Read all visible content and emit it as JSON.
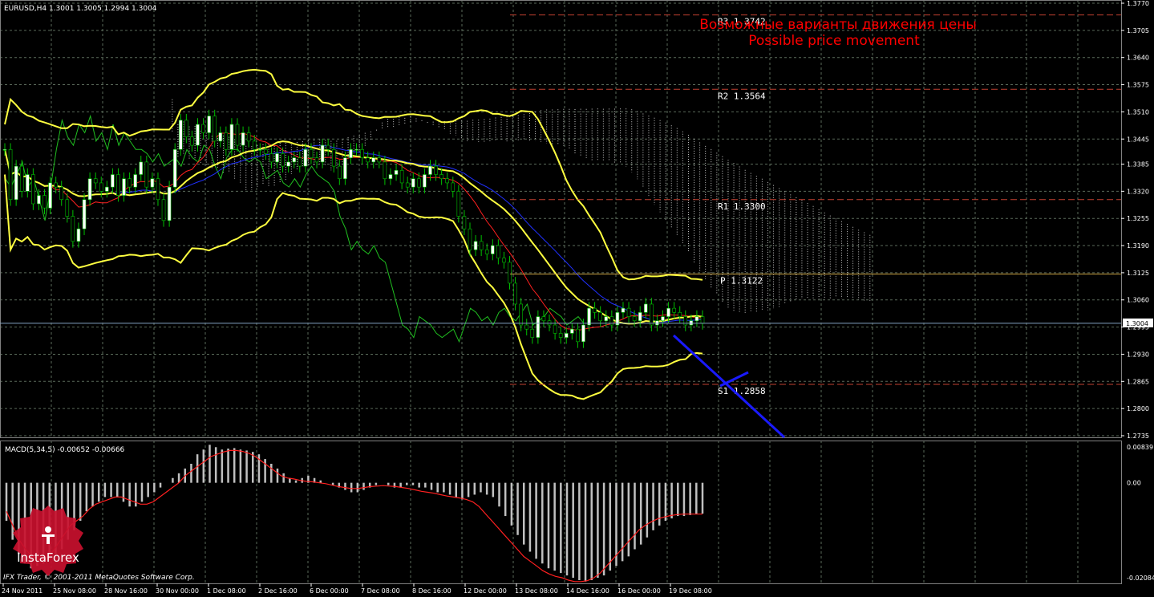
{
  "colors": {
    "background": "#000000",
    "grid": "#5a6a5a",
    "bull": "#ffffff",
    "bear": "#000000",
    "wick": "#00c000",
    "bollinger": "#ffff40",
    "tenkan": "#ff2020",
    "kijun": "#2030ff",
    "chikou": "#20c020",
    "cloud": "#c8c8c8",
    "pivot_level": "#c04030",
    "pivot_p": "#c8a040",
    "forecast": "#1a1aff",
    "price_line": "#80a0c0",
    "annotation": "#ff0000",
    "macd_hist": "#c0c0c0",
    "macd_signal": "#ff2020",
    "axis_text": "#ffffff"
  },
  "header": {
    "symbol_info": "EURUSD,H4  1.3001 1.3005 1.2994 1.3004"
  },
  "annotation": {
    "line1": "Возможные варианты движения цены",
    "line2": "Possible price movement"
  },
  "pivots": [
    {
      "label": "R3",
      "value": "1.3742",
      "price": 1.3742
    },
    {
      "label": "R2",
      "value": "1.3564",
      "price": 1.3564
    },
    {
      "label": "R1",
      "value": "1.3300",
      "price": 1.33
    },
    {
      "label": "P",
      "value": "1.3122",
      "price": 1.3122
    },
    {
      "label": "S1",
      "value": "1.2858",
      "price": 1.2858
    }
  ],
  "current_price": "1.3004",
  "macd": {
    "label": "MACD(5,34,5) -0.00652 -0.00666",
    "yticks": [
      "0.00839",
      "0.00",
      "-0.02084"
    ]
  },
  "footer": {
    "copyright": "IFX Trader, © 2001-2011 MetaQuotes Software Corp."
  },
  "logo": {
    "brand": "InstaForex"
  },
  "chart_data": {
    "type": "candlestick",
    "title": "EURUSD,H4",
    "ylim": [
      1.2735,
      1.377
    ],
    "yticks": [
      "1.3770",
      "1.3705",
      "1.3640",
      "1.3575",
      "1.3510",
      "1.3445",
      "1.3385",
      "1.3320",
      "1.3255",
      "1.3190",
      "1.3125",
      "1.3060",
      "1.2995",
      "1.2930",
      "1.2865",
      "1.2800",
      "1.2735"
    ],
    "xticks": [
      "24 Nov 2011",
      "25 Nov 08:00",
      "28 Nov 16:00",
      "30 Nov 00:00",
      "1 Dec 08:00",
      "2 Dec 16:00",
      "6 Dec 00:00",
      "7 Dec 08:00",
      "8 Dec 16:00",
      "12 Dec 00:00",
      "13 Dec 08:00",
      "14 Dec 16:00",
      "16 Dec 00:00",
      "19 Dec 08:00"
    ],
    "close": [
      1.342,
      1.33,
      1.338,
      1.332,
      1.336,
      1.329,
      1.331,
      1.328,
      1.334,
      1.333,
      1.33,
      1.326,
      1.32,
      1.323,
      1.33,
      1.335,
      1.334,
      1.332,
      1.333,
      1.336,
      1.331,
      1.335,
      1.333,
      1.336,
      1.339,
      1.333,
      1.335,
      1.33,
      1.325,
      1.333,
      1.342,
      1.349,
      1.345,
      1.343,
      1.348,
      1.346,
      1.35,
      1.344,
      1.346,
      1.342,
      1.348,
      1.343,
      1.346,
      1.344,
      1.342,
      1.342,
      1.341,
      1.339,
      1.341,
      1.338,
      1.339,
      1.34,
      1.338,
      1.342,
      1.34,
      1.339,
      1.343,
      1.342,
      1.338,
      1.335,
      1.34,
      1.342,
      1.342,
      1.34,
      1.339,
      1.34,
      1.339,
      1.335,
      1.336,
      1.337,
      1.334,
      1.333,
      1.335,
      1.333,
      1.336,
      1.338,
      1.336,
      1.335,
      1.334,
      1.332,
      1.326,
      1.323,
      1.318,
      1.32,
      1.318,
      1.317,
      1.319,
      1.316,
      1.315,
      1.31,
      1.305,
      1.3,
      1.299,
      1.297,
      1.302,
      1.301,
      1.3,
      1.298,
      1.297,
      1.298,
      1.299,
      1.296,
      1.3,
      1.304,
      1.303,
      1.301,
      1.302,
      1.3,
      1.303,
      1.304,
      1.302,
      1.301,
      1.303,
      1.305,
      1.3,
      1.301,
      1.302,
      1.304,
      1.303,
      1.302,
      1.3,
      1.301,
      1.302,
      1.3004
    ],
    "macd_hist": [
      -0.008,
      -0.012,
      -0.015,
      -0.017,
      -0.018,
      -0.0175,
      -0.017,
      -0.016,
      -0.015,
      -0.014,
      -0.012,
      -0.01,
      -0.008,
      -0.006,
      -0.005,
      -0.004,
      -0.003,
      -0.003,
      -0.003,
      -0.004,
      -0.005,
      -0.005,
      -0.004,
      -0.003,
      -0.002,
      -0.001,
      0.0,
      0.001,
      0.002,
      0.003,
      0.004,
      0.006,
      0.007,
      0.008,
      0.0075,
      0.007,
      0.0072,
      0.0073,
      0.007,
      0.0068,
      0.0065,
      0.006,
      0.005,
      0.004,
      0.003,
      0.002,
      0.001,
      0.0005,
      0.001,
      0.0015,
      0.001,
      0.0005,
      0.0,
      -0.0005,
      -0.001,
      -0.0015,
      -0.002,
      -0.002,
      -0.0015,
      -0.001,
      -0.0005,
      0.0,
      -0.0005,
      -0.001,
      -0.001,
      -0.0005,
      -0.0005,
      -0.001,
      -0.001,
      -0.0015,
      -0.002,
      -0.002,
      -0.0025,
      -0.003,
      -0.0035,
      -0.003,
      -0.0025,
      -0.002,
      -0.0025,
      -0.003,
      -0.005,
      -0.007,
      -0.009,
      -0.011,
      -0.013,
      -0.0145,
      -0.016,
      -0.017,
      -0.018,
      -0.0185,
      -0.019,
      -0.0195,
      -0.02,
      -0.0205,
      -0.0208,
      -0.0205,
      -0.02,
      -0.0195,
      -0.0185,
      -0.0175,
      -0.0165,
      -0.0155,
      -0.014,
      -0.013,
      -0.0115,
      -0.01,
      -0.009,
      -0.008,
      -0.0075,
      -0.007,
      -0.007,
      -0.0068,
      -0.0066,
      -0.0065
    ],
    "macd_signal": [
      -0.006,
      -0.009,
      -0.012,
      -0.014,
      -0.0155,
      -0.016,
      -0.016,
      -0.015,
      -0.013,
      -0.011,
      -0.009,
      -0.008,
      -0.007,
      -0.0055,
      -0.0045,
      -0.004,
      -0.0035,
      -0.003,
      -0.003,
      -0.0035,
      -0.004,
      -0.0045,
      -0.0045,
      -0.004,
      -0.003,
      -0.002,
      -0.001,
      0.0,
      0.0015,
      0.0025,
      0.0035,
      0.0045,
      0.0055,
      0.006,
      0.0065,
      0.0068,
      0.0068,
      0.0066,
      0.0062,
      0.0055,
      0.0045,
      0.0035,
      0.0025,
      0.0015,
      0.001,
      0.0008,
      0.0005,
      0.0003,
      0.0002,
      0.0,
      -0.0002,
      -0.0005,
      -0.0008,
      -0.001,
      -0.0012,
      -0.0012,
      -0.001,
      -0.0008,
      -0.0007,
      -0.0006,
      -0.0007,
      -0.0008,
      -0.001,
      -0.0012,
      -0.0015,
      -0.0018,
      -0.002,
      -0.0022,
      -0.0025,
      -0.0028,
      -0.003,
      -0.0032,
      -0.0035,
      -0.004,
      -0.005,
      -0.0065,
      -0.008,
      -0.0095,
      -0.011,
      -0.0125,
      -0.014,
      -0.0155,
      -0.0165,
      -0.0175,
      -0.0185,
      -0.0192,
      -0.0197,
      -0.02,
      -0.0205,
      -0.0208,
      -0.0208,
      -0.0206,
      -0.02,
      -0.019,
      -0.0175,
      -0.016,
      -0.0145,
      -0.013,
      -0.0115,
      -0.01,
      -0.009,
      -0.0082,
      -0.0076,
      -0.0072,
      -0.0069,
      -0.0067,
      -0.0066,
      -0.0066,
      -0.0066,
      -0.0066
    ]
  }
}
